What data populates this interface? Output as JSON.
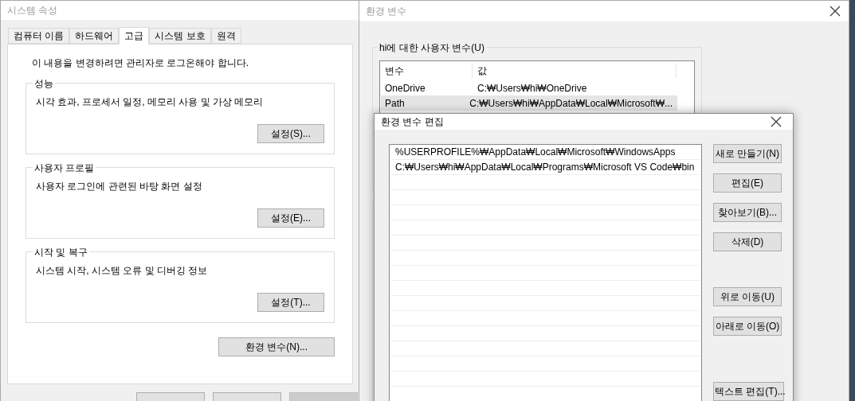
{
  "system_properties": {
    "title": "시스템 속성",
    "active": false,
    "tabs": [
      {
        "label": "컴퓨터 이름",
        "selected": false
      },
      {
        "label": "하드웨어",
        "selected": false
      },
      {
        "label": "고급",
        "selected": true
      },
      {
        "label": "시스템 보호",
        "selected": false
      },
      {
        "label": "원격",
        "selected": false
      }
    ],
    "notice": "이 내용을 변경하려면 관리자로 로그온해야 합니다.",
    "groups": [
      {
        "title": "성능",
        "description": "시각 효과, 프로세서 일정, 메모리 사용 및 가상 메모리",
        "button": "설정(S)..."
      },
      {
        "title": "사용자 프로필",
        "description": "사용자 로그인에 관련된 바탕 화면 설정",
        "button": "설정(E)..."
      },
      {
        "title": "시작 및 복구",
        "description": "시스템 시작, 시스템 오류 및 디버깅 정보",
        "button": "설정(T)..."
      }
    ],
    "env_button": "환경 변수(N)..."
  },
  "environment_variables": {
    "title": "환경 변수",
    "active": false,
    "user_group": "hi에 대한 사용자 변수(U)",
    "columns": [
      "변수",
      "값"
    ],
    "rows": [
      {
        "name": "OneDrive",
        "value": "C:₩Users₩hi₩OneDrive",
        "selected": false
      },
      {
        "name": "Path",
        "value": "C:₩Users₩hi₩AppData₩Local₩Microsoft₩...",
        "selected": true
      }
    ]
  },
  "edit_dialog": {
    "title": "환경 변수 편집",
    "active": true,
    "entries": [
      "%USERPROFILE%₩AppData₩Local₩Microsoft₩WindowsApps",
      "C:₩Users₩hi₩AppData₩Local₩Programs₩Microsoft VS Code₩bin"
    ],
    "button_groups": [
      [
        "새로 만들기(N)",
        "편집(E)",
        "찾아보기(B)...",
        "삭제(D)"
      ],
      [
        "위로 이동(U)",
        "아래로 이동(O)"
      ],
      [
        "텍스트 편집(T)..."
      ]
    ]
  }
}
